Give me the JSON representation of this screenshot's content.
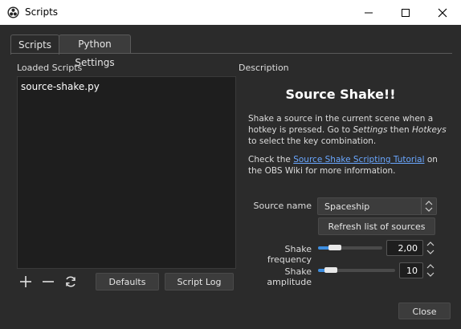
{
  "window": {
    "title": "Scripts"
  },
  "tabs": [
    {
      "label": "Scripts",
      "active": true
    },
    {
      "label": "Python Settings",
      "active": false
    }
  ],
  "left": {
    "loaded_label": "Loaded Scripts",
    "scripts": [
      "source-shake.py"
    ],
    "defaults_label": "Defaults",
    "script_log_label": "Script Log"
  },
  "right": {
    "description_label": "Description",
    "title": "Source Shake!!",
    "para1": {
      "a": "Shake a source in the current scene when a hotkey is pressed. Go to ",
      "b": "Settings",
      "c": " then ",
      "d": "Hotkeys",
      "e": " to select the key combination."
    },
    "para2": {
      "a": "Check the ",
      "link": "Source Shake Scripting Tutorial",
      "b": " on the OBS Wiki for more information."
    },
    "source_name_label": "Source name",
    "source_name_value": "Spaceship",
    "refresh_label": "Refresh list of sources",
    "freq_label": "Shake frequency",
    "freq_value": "2,00",
    "freq_fraction": 0.2,
    "amp_label": "Shake amplitude",
    "amp_value": "10",
    "amp_fraction": 0.1
  },
  "footer": {
    "close_label": "Close"
  },
  "colors": {
    "accent": "#3d8ee0",
    "link": "#6aa7ff",
    "background": "#2b2b2b"
  }
}
